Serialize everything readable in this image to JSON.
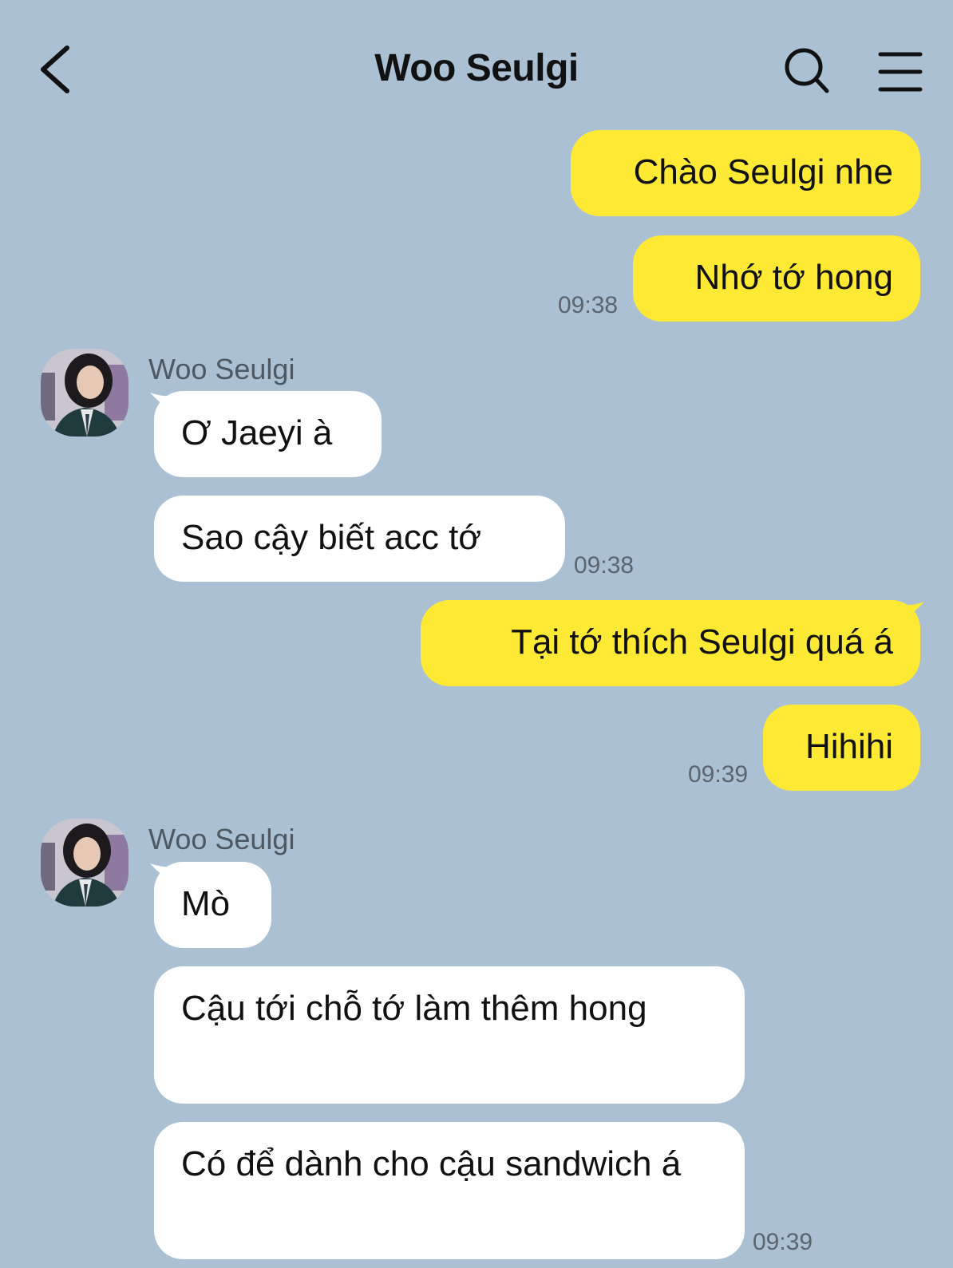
{
  "header": {
    "title": "Woo Seulgi",
    "back_icon": "chevron-left-icon",
    "search_icon": "search-icon",
    "menu_icon": "menu-icon"
  },
  "messages": [
    {
      "from": "me",
      "text": "Chào Seulgi nhe"
    },
    {
      "from": "me",
      "text": "Nhớ tớ hong",
      "time": "09:38"
    },
    {
      "from": "them",
      "sender": "Woo Seulgi",
      "text": "Ơ Jaeyi à"
    },
    {
      "from": "them",
      "text": "Sao cậy biết acc tớ",
      "time": "09:38"
    },
    {
      "from": "me",
      "text": "Tại tớ thích Seulgi quá á"
    },
    {
      "from": "me",
      "text": "Hihihi",
      "time": "09:39"
    },
    {
      "from": "them",
      "sender": "Woo Seulgi",
      "text": "Mò"
    },
    {
      "from": "them",
      "text": "Cậu tới chỗ tớ làm thêm hong"
    },
    {
      "from": "them",
      "text": "Có để dành cho cậu sandwich á",
      "time": "09:39"
    }
  ],
  "colors": {
    "background": "#abc1d3",
    "my_bubble": "#fee934",
    "their_bubble": "#ffffff"
  }
}
